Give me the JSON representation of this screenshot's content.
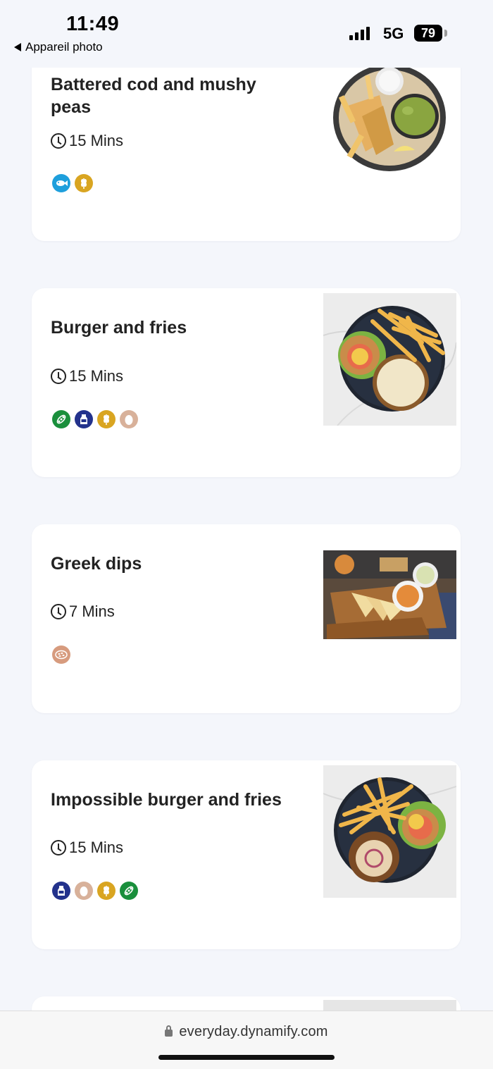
{
  "status": {
    "time": "11:49",
    "back_label": "Appareil photo",
    "network": "5G",
    "battery": "79"
  },
  "recipes": [
    {
      "title": "Battered cod and mushy peas",
      "time": "15 Mins",
      "icons": [
        "fish-icon",
        "wheat-icon"
      ]
    },
    {
      "title": "Burger and fries",
      "time": "15 Mins",
      "icons": [
        "soy-icon",
        "milk-icon",
        "wheat-icon",
        "egg-icon"
      ]
    },
    {
      "title": "Greek dips",
      "time": "7 Mins",
      "icons": [
        "sesame-icon"
      ]
    },
    {
      "title": "Impossible burger and fries",
      "time": "15 Mins",
      "icons": [
        "milk-icon",
        "egg-icon",
        "wheat-icon",
        "soy-icon"
      ]
    }
  ],
  "colors": {
    "fish": "#1e9fdc",
    "wheat": "#d9a521",
    "soy": "#1a8f3c",
    "milk": "#23328c",
    "egg": "#d8b19a",
    "sesame": "#d79b7e"
  },
  "browser": {
    "url": "everyday.dynamify.com"
  }
}
